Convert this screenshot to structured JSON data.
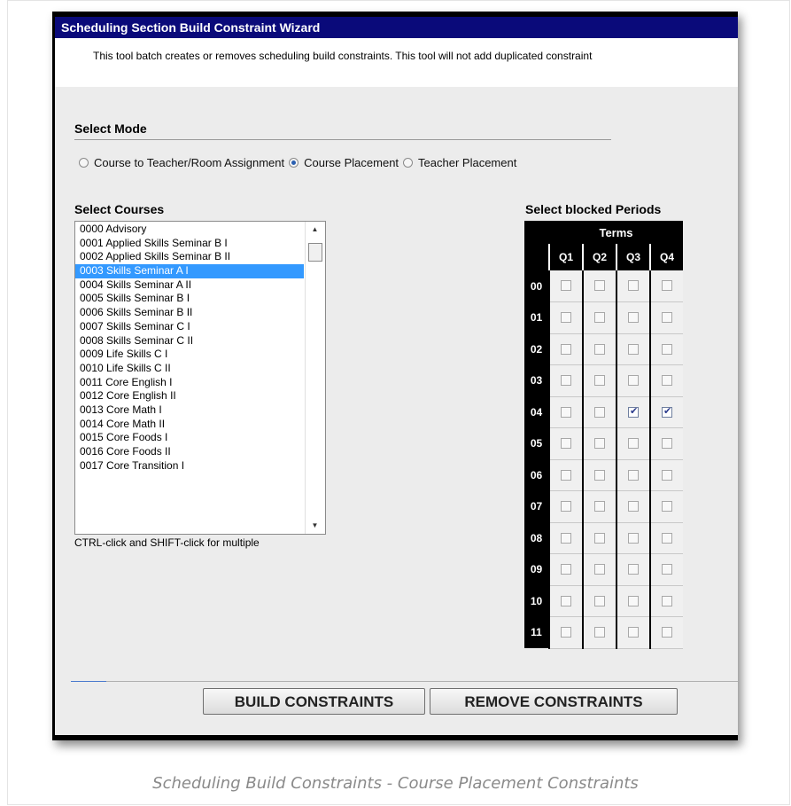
{
  "wizard": {
    "title": "Scheduling Section Build Constraint Wizard",
    "description": "This tool batch creates or removes scheduling build constraints. This tool will not add duplicated constraint"
  },
  "mode": {
    "label": "Select Mode",
    "options": [
      {
        "label": "Course to Teacher/Room Assignment",
        "checked": false
      },
      {
        "label": "Course Placement",
        "checked": true
      },
      {
        "label": "Teacher Placement",
        "checked": false
      }
    ]
  },
  "courses": {
    "label": "Select Courses",
    "items": [
      "0000 Advisory",
      "0001 Applied Skills Seminar B I",
      "0002 Applied Skills Seminar B II",
      "0003 Skills Seminar A I",
      "0004 Skills Seminar A II",
      "0005 Skills Seminar B I",
      "0006 Skills Seminar B II",
      "0007 Skills Seminar C I",
      "0008 Skills Seminar C II",
      "0009 Life Skills C I",
      "0010 Life Skills C II",
      "0011 Core English I",
      "0012 Core English II",
      "0013 Core Math I",
      "0014 Core Math II",
      "0015 Core Foods I",
      "0016 Core Foods II",
      "0017 Core Transition I"
    ],
    "selected_index": 3,
    "hint": "CTRL-click and SHIFT-click for multiple"
  },
  "periods": {
    "label": "Select blocked Periods",
    "terms_label": "Terms",
    "terms": [
      "Q1",
      "Q2",
      "Q3",
      "Q4"
    ],
    "rows": [
      "00",
      "01",
      "02",
      "03",
      "04",
      "05",
      "06",
      "07",
      "08",
      "09",
      "10",
      "11"
    ],
    "checked": [
      [
        4,
        2
      ],
      [
        4,
        3
      ]
    ]
  },
  "buttons": {
    "build": "BUILD CONSTRAINTS",
    "remove": "REMOVE CONSTRAINTS"
  },
  "caption": "Scheduling Build Constraints - Course Placement Constraints",
  "colors": {
    "title_bar": "#0a0a7a",
    "selection": "#3399ff",
    "panel": "#ececec"
  }
}
